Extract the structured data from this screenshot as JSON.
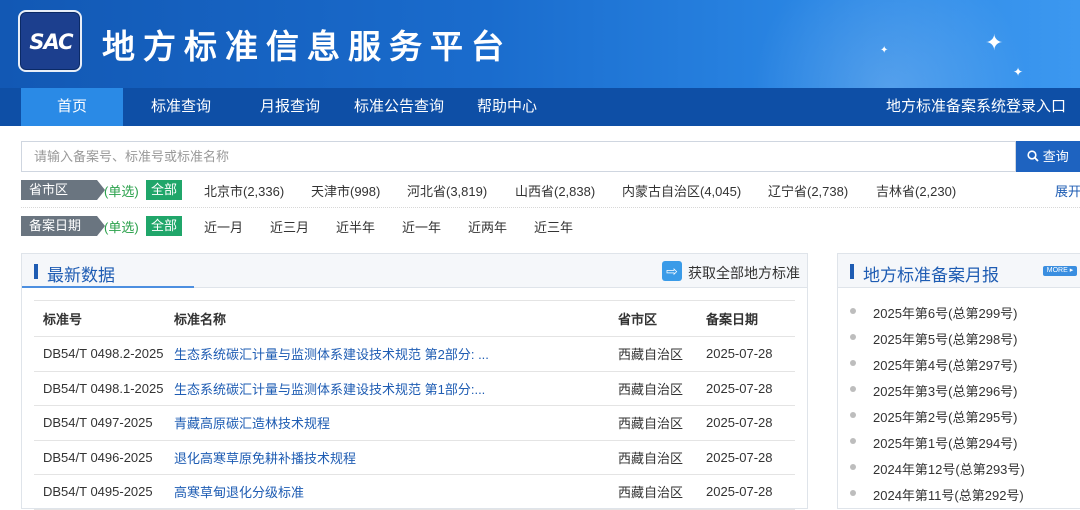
{
  "header": {
    "logo_text": "SAC",
    "site_title": "地方标准信息服务平台"
  },
  "nav": {
    "items": [
      "首页",
      "标准查询",
      "月报查询",
      "标准公告查询",
      "帮助中心"
    ],
    "active": "首页",
    "right_link": "地方标准备案系统登录入口"
  },
  "search": {
    "placeholder": "请输入备案号、标准号或标准名称",
    "button_label": "查询",
    "button_icon": "search-icon"
  },
  "filters": {
    "province": {
      "label": "省市区",
      "mode": "(单选)",
      "all": "全部",
      "options": [
        "北京市(2,336)",
        "天津市(998)",
        "河北省(3,819)",
        "山西省(2,838)",
        "内蒙古自治区(4,045)",
        "辽宁省(2,738)",
        "吉林省(2,230)"
      ],
      "expand": "展开"
    },
    "date": {
      "label": "备案日期",
      "mode": "(单选)",
      "all": "全部",
      "options": [
        "近一月",
        "近三月",
        "近半年",
        "近一年",
        "近两年",
        "近三年"
      ]
    }
  },
  "latest": {
    "title": "最新数据",
    "download_label": "获取全部地方标准",
    "columns": [
      "标准号",
      "标准名称",
      "省市区",
      "备案日期"
    ],
    "rows": [
      [
        "DB54/T 0498.2-2025",
        "生态系统碳汇计量与监测体系建设技术规范 第2部分: ...",
        "西藏自治区",
        "2025-07-28"
      ],
      [
        "DB54/T 0498.1-2025",
        "生态系统碳汇计量与监测体系建设技术规范 第1部分:...",
        "西藏自治区",
        "2025-07-28"
      ],
      [
        "DB54/T 0497-2025",
        "青藏高原碳汇造林技术规程",
        "西藏自治区",
        "2025-07-28"
      ],
      [
        "DB54/T 0496-2025",
        "退化高寒草原免耕补播技术规程",
        "西藏自治区",
        "2025-07-28"
      ],
      [
        "DB54/T 0495-2025",
        "高寒草甸退化分级标准",
        "西藏自治区",
        "2025-07-28"
      ]
    ]
  },
  "monthly": {
    "title": "地方标准备案月报",
    "more_label": "MORE ▸",
    "items": [
      "2025年第6号(总第299号)",
      "2025年第5号(总第298号)",
      "2025年第4号(总第297号)",
      "2025年第3号(总第296号)",
      "2025年第2号(总第295号)",
      "2025年第1号(总第294号)",
      "2024年第12号(总第293号)",
      "2024年第11号(总第292号)"
    ]
  },
  "colors": {
    "header_blue": "#1a6ccd",
    "nav_blue": "#0e4fa6",
    "nav_active": "#2a8ae6",
    "link_blue": "#1e5cb3",
    "all_green": "#20a66a"
  }
}
